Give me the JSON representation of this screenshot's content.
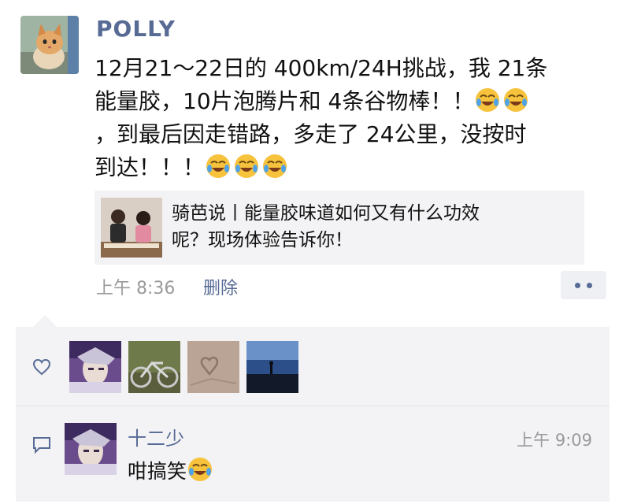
{
  "post": {
    "author": "POLLY",
    "text_line1": "12月21～22日的 400km/24H挑战，我 21条",
    "text_line2": "能量胶，10片泡腾片和 4条谷物棒！！",
    "text_line3": "，到最后因走错路，多走了 24公里，没按时",
    "text_line4": "到达！！！",
    "link_title_line1": "骑芭说丨能量胶味道如何又有什么功效",
    "link_title_line2": "呢？现场体验告诉你！",
    "time": "上午 8:36",
    "delete_label": "删除"
  },
  "likes": {
    "count_shown": 4,
    "icons": [
      "heart-icon"
    ]
  },
  "comments": [
    {
      "author": "十二少",
      "time": "上午 9:09",
      "text": "咁搞笑"
    }
  ],
  "colors": {
    "link_blue": "#576b95",
    "meta_gray": "#9a9a9a",
    "panel_bg": "#f3f3f5",
    "emoji_yellow": "#f7c23c"
  }
}
